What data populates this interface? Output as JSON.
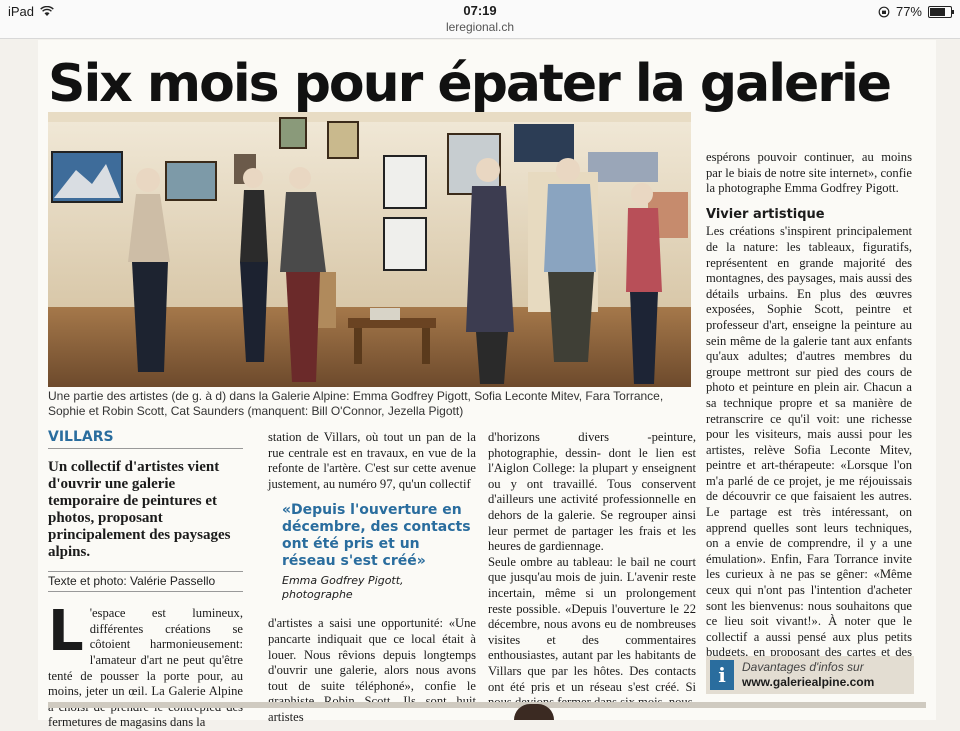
{
  "statusbar": {
    "device": "iPad",
    "time": "07:19",
    "url": "leregional.ch",
    "battery_percent": 77,
    "battery_text": "77%"
  },
  "article": {
    "headline": "Six mois pour épater la galerie",
    "caption": "Une partie des artistes (de g. à d) dans la Galerie Alpine: Emma Godfrey Pigott, Sofia Leconte Mitev, Fara Torrance, Sophie et Robin Scott, Cat Saunders (manquent: Bill O'Connor, Jezella Pigott)",
    "rubric": "VILLARS",
    "chapeau": "Un collectif d'artistes vient d'ouvrir une galerie temporaire de peintures et photos, proposant principalement des paysages alpins.",
    "credit": "Texte et photo: Valérie Passello",
    "dropcap": "L",
    "col1_text": "'espace est lumineux, différentes créations se côtoient harmonieusement: l'amateur d'art ne peut qu'être tenté de pousser la porte pour, au moins, jeter un œil. La Galerie Alpine a choisi de prendre le contrepied des fermetures de magasins dans la",
    "col2_text_a": "station de Villars, où tout un pan de la rue centrale est en travaux, en vue de la refonte de l'artère. C'est sur cette avenue justement, au numéro 97, qu'un collectif",
    "quote": {
      "text": "«Depuis l'ouverture en décembre, des contacts ont été pris et un réseau s'est créé»",
      "author": "Emma Godfrey Pigott, photographe"
    },
    "col2_text_b": "d'artistes a saisi une opportunité: «Une pancarte indiquait que ce local était à louer. Nous rêvions depuis longtemps d'ouvrir une galerie, alors nous avons tout de suite téléphoné», confie le graphiste Robin Scott. Ils sont huit artistes",
    "col3_text_a": "d'horizons divers -peinture, photographie, dessin- dont le lien est l'Aiglon College: la plupart y enseignent ou y ont travaillé. Tous conservent d'ailleurs une activité professionnelle en dehors de la galerie. Se regrouper ainsi leur permet de partager les frais et les heures de gardiennage.",
    "col3_text_b": "Seule ombre au tableau: le bail ne court que jusqu'au mois de juin. L'avenir reste incertain, même si un prolongement reste possible. «Depuis l'ouverture le 22 décembre, nous avons eu de nombreuses visites et des commentaires enthousiastes, autant par les habitants de Villars que par les hôtes. Des contacts ont été pris et un réseau s'est créé. Si nous devions fermer dans six mois, nous",
    "col4_text_a": "espérons pouvoir continuer, au moins par le biais de notre site internet», confie la photographe Emma Godfrey Pigott.",
    "subhead": "Vivier artistique",
    "col4_text_b": "Les créations s'inspirent principalement de la nature: les tableaux, figuratifs, représentent en grande majorité des montagnes, des paysages, mais aussi des détails urbains. En plus des œuvres exposées, Sophie Scott, peintre et professeur d'art, enseigne la peinture au sein même de la galerie tant aux enfants qu'aux adultes; d'autres membres du groupe mettront sur pied des cours de photo et peinture en plein air. Chacun a sa technique propre et sa manière de retranscrire ce qu'il voit: une richesse pour les visiteurs, mais aussi pour les artistes, relève Sofia Leconte Mitev, peintre et art-thérapeute: «Lorsque l'on m'a parlé de ce projet, je me réjouissais de découvrir ce que faisaient les autres. Le partage est très intéressant, on apprend quelles sont leurs techniques, on a envie de comprendre, il y a une émulation». Enfin, Fara Torrance invite les curieux à ne pas se gêner: «Même ceux qui n'ont pas l'intention d'acheter sont les bienvenus: nous souhaitons que ce lieu soit vivant!». À noter que le collectif a aussi pensé aux plus petits budgets, en proposant des cartes et des lithographies en tirages limités.",
    "infobox": {
      "icon": "i",
      "line1": "Davantages d'infos sur",
      "line2": "www.galeriealpine.com"
    }
  },
  "colors": {
    "accent": "#2a6d9e",
    "infobox_bg": "#e3ddd2"
  }
}
